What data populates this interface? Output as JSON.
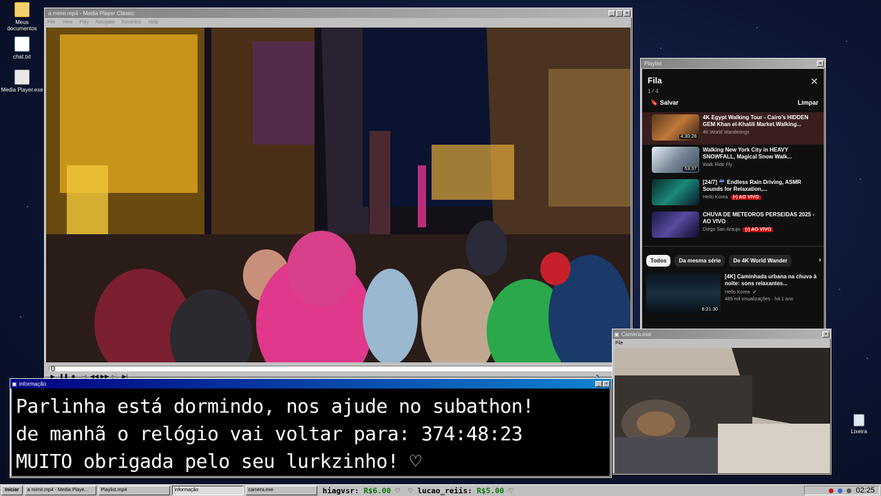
{
  "desktop": {
    "icons": [
      {
        "label": "Meus documentos"
      },
      {
        "label": "chat.txt"
      },
      {
        "label": "Media Player.exe"
      },
      {
        "label": "Lixeira"
      }
    ]
  },
  "mpc": {
    "title": "a mimir.mp4 - Media Player Classic",
    "menu": [
      "File",
      "View",
      "Play",
      "Navigate",
      "Favorites",
      "Help"
    ]
  },
  "playlist_window": {
    "title": "Playlist",
    "header": "Fila",
    "count": "1 / 4",
    "save_label": "Salvar",
    "clear_label": "Limpar",
    "items": [
      {
        "title": "4K Egypt Walking Tour - Cairo's HIDDEN GEM Khan el-Khalili Market Walking...",
        "channel": "4K World Wanderings",
        "duration": "4:30:28",
        "selected": true
      },
      {
        "title": "Walking New York City in HEAVY SNOWFALL, Magical Snow Walk...",
        "channel": "Walk Ride Fly",
        "duration": "53:37"
      },
      {
        "title": "[24/7] ☔ Endless Rain Driving, ASMR Sounds for Relaxation,...",
        "channel": "Hello Korea",
        "badge": "(•) AO VIVO"
      },
      {
        "title": "CHUVA DE METEOROS PERSEIDAS 2025 - AO VIVO",
        "channel": "Diego San Araujo",
        "badge": "(•) AO VIVO"
      }
    ],
    "chips": [
      "Todos",
      "Da mesma série",
      "De 4K World Wander"
    ],
    "recommended": {
      "title": "[4K] Caminhada urbana na chuva à noite: sons relaxantes...",
      "channel": "Hello Korea",
      "stats": "485 mil visualizações · há 1 ano",
      "duration": "8:21:30"
    }
  },
  "camera": {
    "title": "Camera.exe",
    "menu": "File"
  },
  "info": {
    "title": "informação",
    "lines": [
      "Parlinha está dormindo, nos ajude no subathon!",
      "de manhã o relógio vai voltar para:  374:48:23",
      "MUITO obrigada pelo seu lurkzinho! ♡"
    ]
  },
  "taskbar": {
    "start": "Iniciar",
    "tasks": [
      "a mimir.mp4 - Media Playe...",
      "Playlist.mp4",
      "informação",
      "camera.exe"
    ],
    "donations": [
      {
        "user": "hiagvsr:",
        "amount": "R$6.00"
      },
      {
        "user": "lucao_reiis:",
        "amount": "R$5.00"
      }
    ],
    "clock": "02:25"
  },
  "colors": {
    "titlebar_active": "#000080",
    "live_badge": "#cc0000",
    "desktop": "#0c1533"
  }
}
